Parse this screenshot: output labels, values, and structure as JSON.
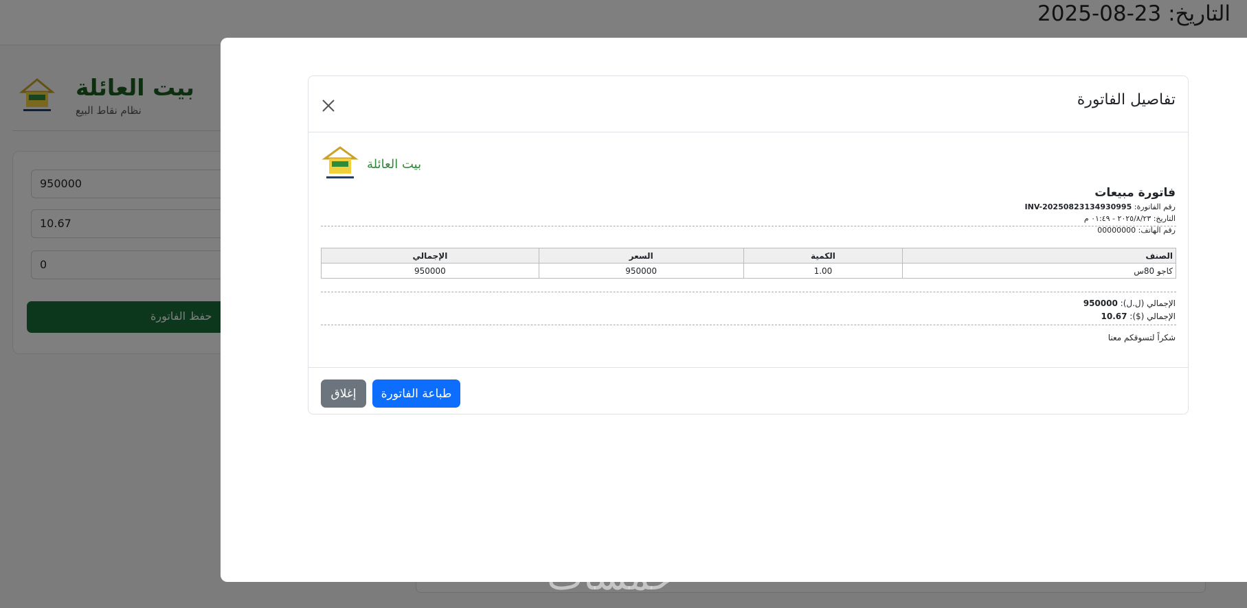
{
  "background": {
    "date_text": "التاريخ: 23-08-2025",
    "brand_title": "بيت العائلة",
    "brand_subtitle": "نظام نقاط البيع",
    "inputs": [
      "950000",
      "10.67",
      "0"
    ],
    "save_button_label": "حفظ الفاتورة"
  },
  "modal": {
    "title": "تفاصيل الفاتورة",
    "store_name": "بيت العائلة",
    "receipt": {
      "heading": "فاتورة مبيعات",
      "invoice_label": "رقم الفاتورة:",
      "invoice_number": "INV-20250823134930995",
      "date_line": "التاريخ: ٢٠٢٥/٨/٢٣ - ٠١:٤٩ م",
      "phone_line": "رقم الهاتف: 00000000"
    },
    "table": {
      "headers": {
        "item": "الصنف",
        "qty": "الكمية",
        "price": "السعر",
        "total": "الإجمالي"
      },
      "rows": [
        {
          "item": "كاجو 80س",
          "qty": "1.00",
          "price": "950000",
          "total": "950000"
        }
      ]
    },
    "totals": {
      "lbp_label": "الإجمالي (ل.ل):",
      "lbp_value": "950000",
      "usd_label": "الإجمالي ($):",
      "usd_value": "10.67"
    },
    "thanks": "شكراً لتسوقكم معنا",
    "print_button": "طباعة الفاتورة",
    "close_button": "إغلاق"
  },
  "colors": {
    "brand_green": "#1b5e20",
    "print_blue": "#0d6efd",
    "close_gray": "#6c757d"
  },
  "icons": {
    "close": "close-icon",
    "logo": "house-logo-icon"
  },
  "watermark": "خمسات"
}
